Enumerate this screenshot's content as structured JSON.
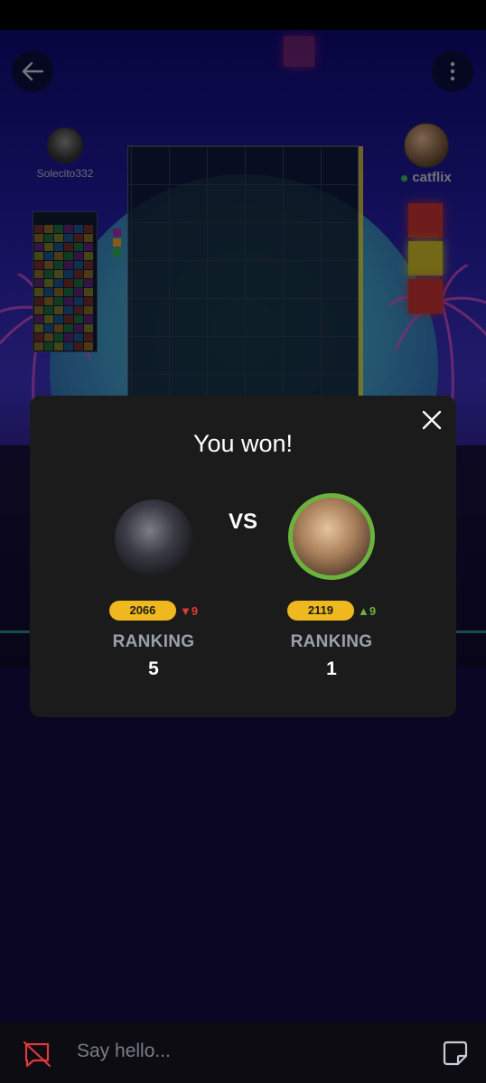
{
  "opponents": {
    "left": {
      "name": "Solecito332"
    },
    "right": {
      "name": "catflix",
      "status": "online"
    }
  },
  "board": {
    "accent": "#e6d230"
  },
  "queue_colors": [
    "#e03a3a",
    "#e6d230",
    "#e03a3a"
  ],
  "result": {
    "title": "You won!",
    "vs_label": "VS",
    "players": [
      {
        "rating": "2066",
        "delta": "9",
        "delta_direction": "down",
        "rank_label": "RANKING",
        "rank": "5"
      },
      {
        "rating": "2119",
        "delta": "9",
        "delta_direction": "up",
        "rank_label": "RANKING",
        "rank": "1"
      }
    ]
  },
  "chat": {
    "placeholder": "Say hello..."
  },
  "icons": [
    "back-arrow-icon",
    "more-vertical-icon",
    "close-icon",
    "chat-off-icon",
    "sticker-icon"
  ],
  "colors": {
    "rating_pill": "#f0b81f",
    "win_ring": "#6bb33d",
    "down": "#e03a3a",
    "up": "#6bb33d"
  }
}
